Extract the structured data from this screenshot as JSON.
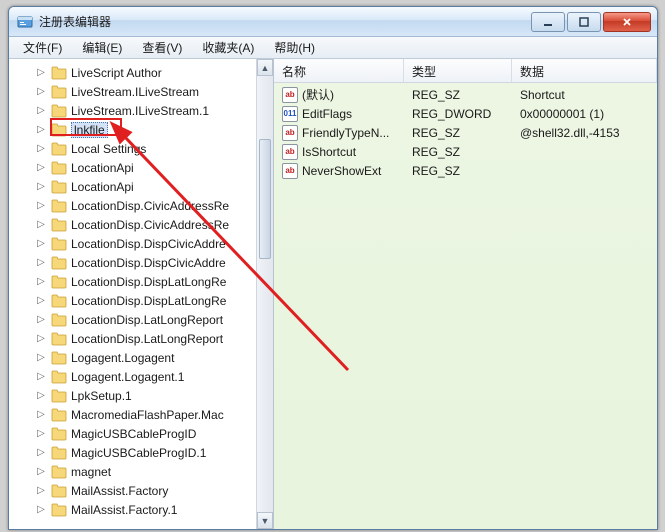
{
  "window": {
    "title": "注册表编辑器"
  },
  "menu": {
    "file": "文件(F)",
    "edit": "编辑(E)",
    "view": "查看(V)",
    "favorites": "收藏夹(A)",
    "help": "帮助(H)"
  },
  "tree": {
    "items": [
      {
        "label": "LiveScript Author"
      },
      {
        "label": "LiveStream.ILiveStream"
      },
      {
        "label": "LiveStream.ILiveStream.1"
      },
      {
        "label": "lnkfile",
        "selected": true
      },
      {
        "label": "Local Settings"
      },
      {
        "label": "LocationApi"
      },
      {
        "label": "LocationApi"
      },
      {
        "label": "LocationDisp.CivicAddressRe"
      },
      {
        "label": "LocationDisp.CivicAddressRe"
      },
      {
        "label": "LocationDisp.DispCivicAddre"
      },
      {
        "label": "LocationDisp.DispCivicAddre"
      },
      {
        "label": "LocationDisp.DispLatLongRe"
      },
      {
        "label": "LocationDisp.DispLatLongRe"
      },
      {
        "label": "LocationDisp.LatLongReport"
      },
      {
        "label": "LocationDisp.LatLongReport"
      },
      {
        "label": "Logagent.Logagent"
      },
      {
        "label": "Logagent.Logagent.1"
      },
      {
        "label": "LpkSetup.1"
      },
      {
        "label": "MacromediaFlashPaper.Mac"
      },
      {
        "label": "MagicUSBCableProgID"
      },
      {
        "label": "MagicUSBCableProgID.1"
      },
      {
        "label": "magnet"
      },
      {
        "label": "MailAssist.Factory"
      },
      {
        "label": "MailAssist.Factory.1"
      }
    ]
  },
  "list": {
    "headers": {
      "name": "名称",
      "type": "类型",
      "data": "数据"
    },
    "rows": [
      {
        "icon": "str",
        "name": "(默认)",
        "type": "REG_SZ",
        "data": "Shortcut"
      },
      {
        "icon": "bin",
        "name": "EditFlags",
        "type": "REG_DWORD",
        "data": "0x00000001 (1)"
      },
      {
        "icon": "str",
        "name": "FriendlyTypeN...",
        "type": "REG_SZ",
        "data": "@shell32.dll,-4153"
      },
      {
        "icon": "str",
        "name": "IsShortcut",
        "type": "REG_SZ",
        "data": ""
      },
      {
        "icon": "str",
        "name": "NeverShowExt",
        "type": "REG_SZ",
        "data": ""
      }
    ]
  },
  "icons": {
    "str_glyph": "ab",
    "bin_glyph": "011"
  }
}
